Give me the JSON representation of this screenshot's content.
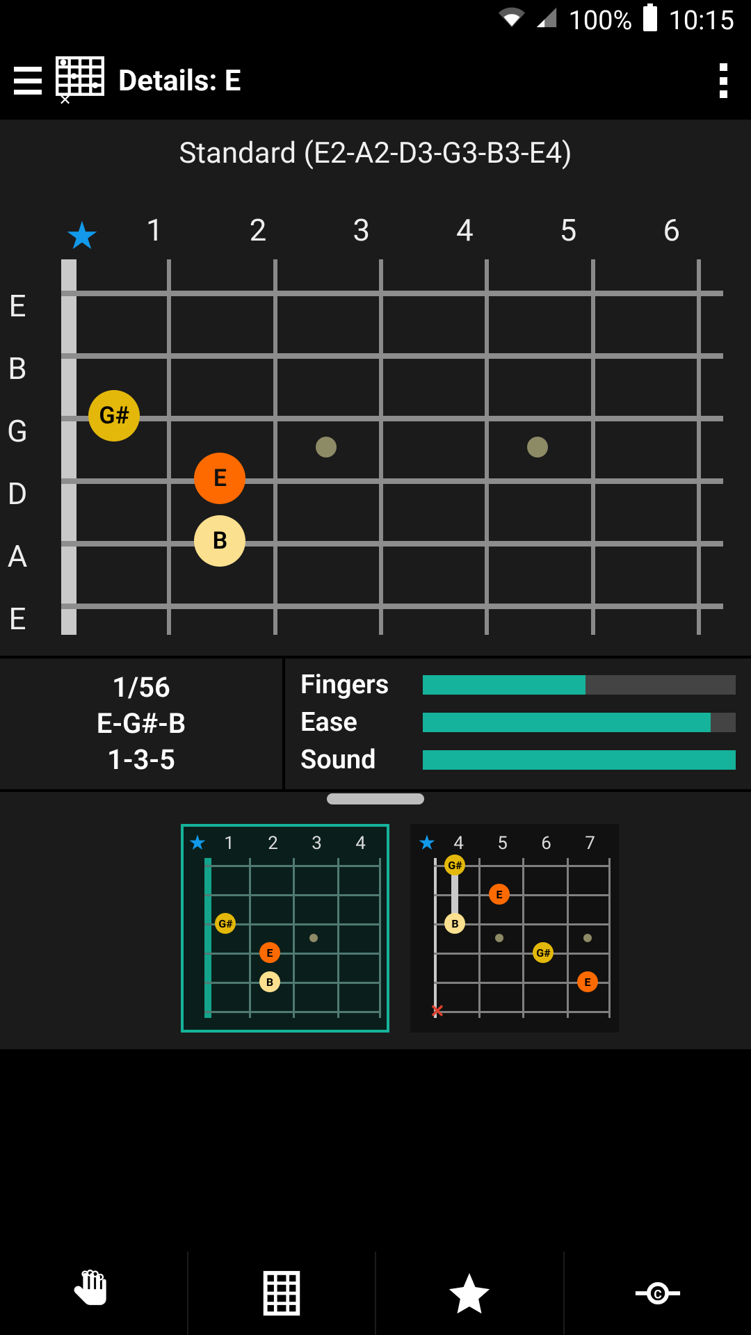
{
  "status": {
    "battery": "100%",
    "time": "10:15"
  },
  "appbar": {
    "title": "Details: E"
  },
  "tuning": "Standard (E2-A2-D3-G3-B3-E4)",
  "main_board": {
    "string_labels": [
      "E",
      "B",
      "G",
      "D",
      "A",
      "E"
    ],
    "fret_numbers": [
      "1",
      "2",
      "3",
      "4",
      "5",
      "6"
    ],
    "notes": {
      "gs": "G#",
      "e": "E",
      "b": "B"
    }
  },
  "info": {
    "position": "1/56",
    "notes": "E-G#-B",
    "intervals": "1-3-5",
    "metrics": {
      "fingers": {
        "label": "Fingers",
        "pct": 52
      },
      "ease": {
        "label": "Ease",
        "pct": 92
      },
      "sound": {
        "label": "Sound",
        "pct": 100
      }
    }
  },
  "variations": {
    "v1": {
      "frets": [
        "1",
        "2",
        "3",
        "4"
      ],
      "selected": true,
      "notes": {
        "gs": "G#",
        "e": "E",
        "b": "B"
      }
    },
    "v2": {
      "frets": [
        "4",
        "5",
        "6",
        "7"
      ],
      "selected": false,
      "notes": {
        "gs1": "G#",
        "e1": "E",
        "b": "B",
        "gs2": "G#",
        "e2": "E"
      }
    }
  },
  "bottom_tabs": [
    "hand",
    "grid",
    "star",
    "capo"
  ]
}
